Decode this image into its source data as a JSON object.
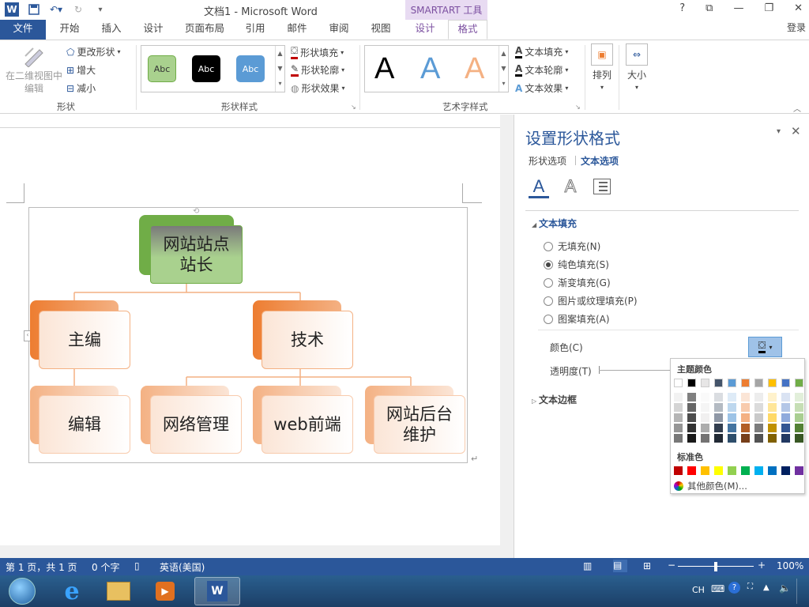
{
  "title": {
    "window_title": "文档1 - Microsoft Word",
    "smartart_tools": "SMARTART 工具"
  },
  "window_controls": [
    "?",
    "⧉",
    "—",
    "❐",
    "✕"
  ],
  "tabs": [
    "文件",
    "开始",
    "插入",
    "设计",
    "页面布局",
    "引用",
    "邮件",
    "审阅",
    "视图",
    "设计",
    "格式"
  ],
  "login": "登录",
  "ribbon": {
    "shape_group": {
      "edit_2d": "在二维视图中\n编辑",
      "change_shape": "更改形状",
      "larger": "增大",
      "smaller": "减小",
      "label": "形状"
    },
    "shape_styles": {
      "sample": "Abc",
      "fill": "形状填充",
      "outline": "形状轮廓",
      "effects": "形状效果",
      "label": "形状样式"
    },
    "wordart": {
      "letter": "A",
      "text_fill": "文本填充",
      "text_outline": "文本轮廓",
      "text_effects": "文本效果",
      "label": "艺术字样式"
    },
    "arrange": "排列",
    "size": "大小"
  },
  "diagram": {
    "root": "网站站点\n站长",
    "level2": [
      "主编",
      "技术"
    ],
    "level3": [
      "编辑",
      "网络管理",
      "web前端",
      "网站后台\n维护"
    ]
  },
  "pane": {
    "title": "设置形状格式",
    "tabs": [
      "形状选项",
      "文本选项"
    ],
    "section_text_fill": "文本填充",
    "options": [
      "无填充(N)",
      "纯色填充(S)",
      "渐变填充(G)",
      "图片或纹理填充(P)",
      "图案填充(A)"
    ],
    "selected_option": "纯色填充(S)",
    "color_label": "颜色(C)",
    "transparency_label": "透明度(T)",
    "section_text_border": "文本边框"
  },
  "color_picker": {
    "theme_label": "主题颜色",
    "standard_label": "标准色",
    "more_colors": "其他颜色(M)...",
    "theme_top": [
      "#ffffff",
      "#000000",
      "#e7e6e6",
      "#44546a",
      "#5b9bd5",
      "#ed7d31",
      "#a5a5a5",
      "#ffc000",
      "#4472c4",
      "#70ad47"
    ],
    "standard": [
      "#c00000",
      "#ff0000",
      "#ffc000",
      "#ffff00",
      "#92d050",
      "#00b050",
      "#00b0f0",
      "#0070c0",
      "#002060",
      "#7030a0"
    ]
  },
  "status": {
    "page": "第 1 页，共 1 页",
    "words": "0 个字",
    "language": "英语(美国)",
    "zoom": "100%"
  },
  "tray": {
    "ime": "CH"
  }
}
